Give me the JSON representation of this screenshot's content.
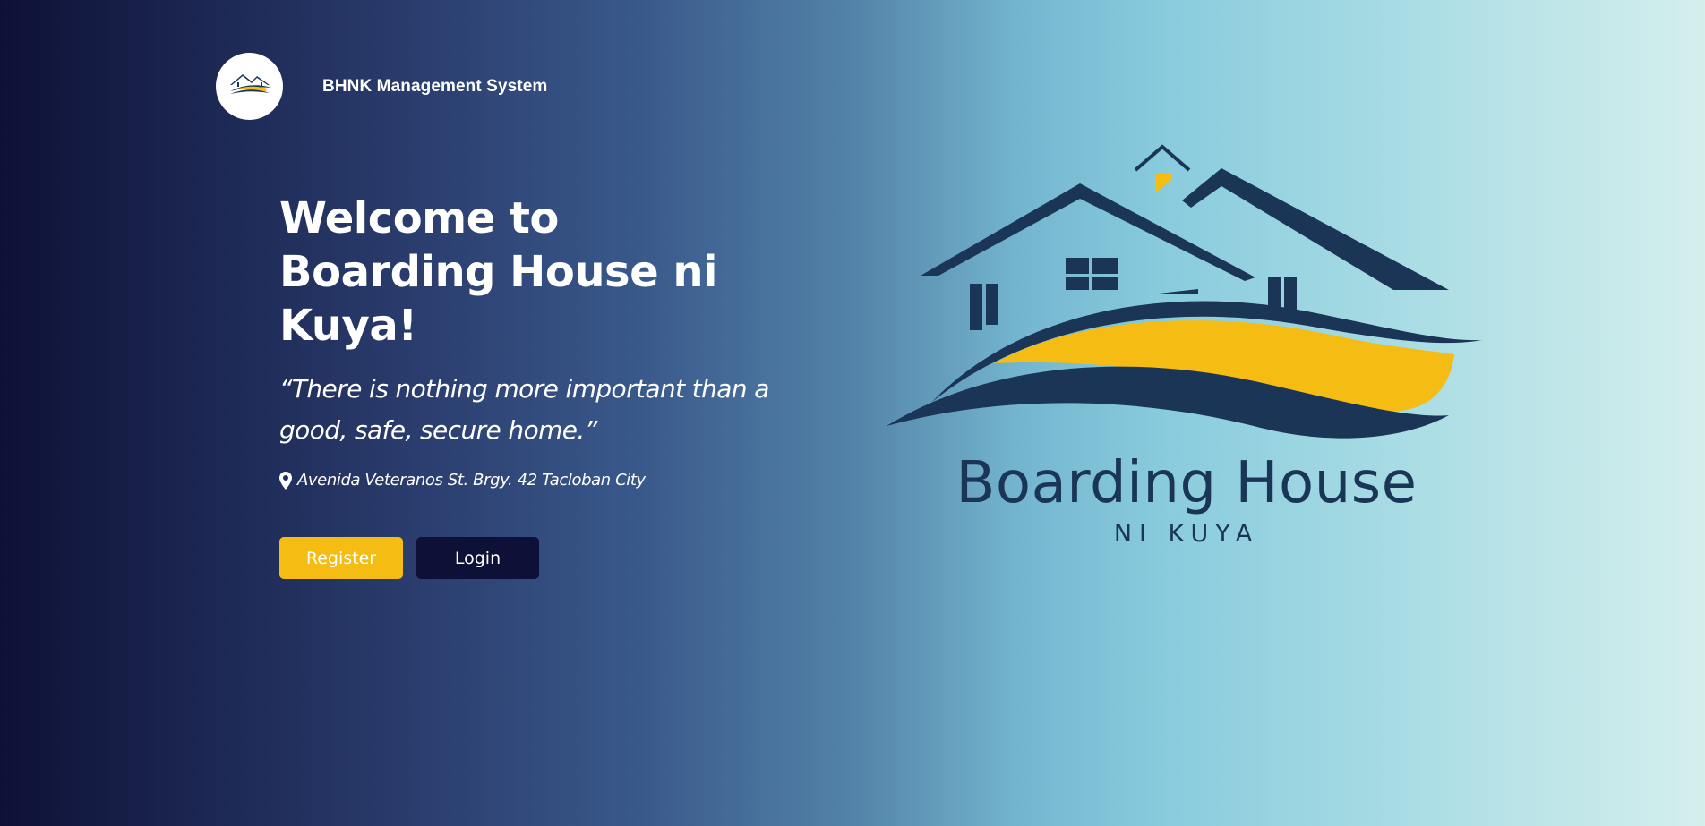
{
  "brand": {
    "title": "BHNK Management System",
    "logo_text_main": "Boarding House",
    "logo_text_sub": "NI KUYA"
  },
  "hero": {
    "title": "Welcome to Boarding House ni Kuya!",
    "quote": "“There is nothing more important than a good, safe, secure home.”",
    "address": "Avenida Veteranos St. Brgy. 42 Tacloban City",
    "address_icon": "map-pin-icon"
  },
  "buttons": {
    "register_label": "Register",
    "login_label": "Login"
  },
  "colors": {
    "accent_yellow": "#f5bc13",
    "navy": "#0e1137",
    "logo_dark": "#1a3556"
  }
}
